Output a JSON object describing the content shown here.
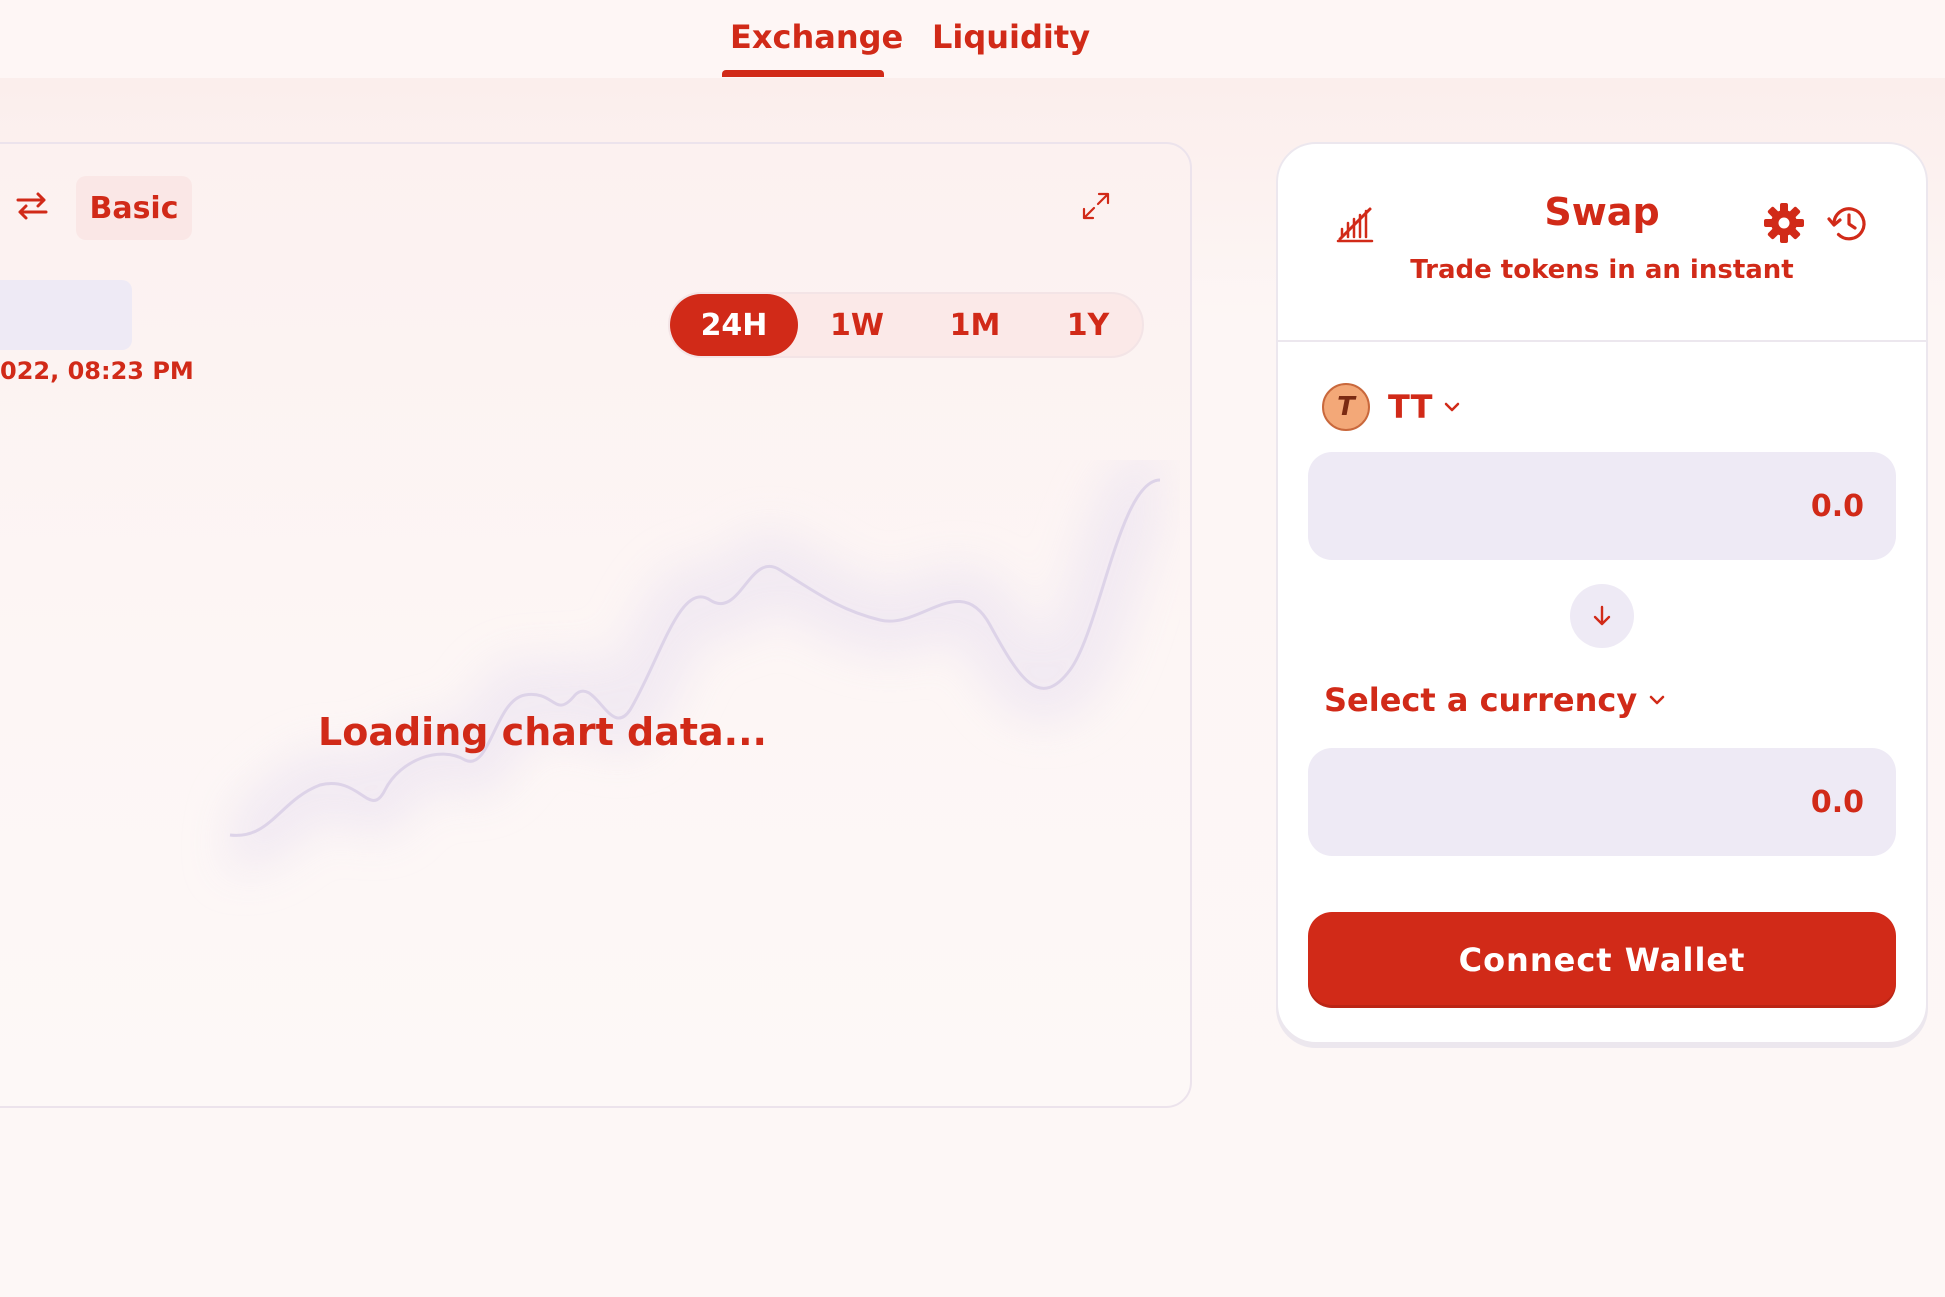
{
  "nav": {
    "tabs": [
      {
        "label": "Exchange",
        "active": true
      },
      {
        "label": "Liquidity",
        "active": false
      }
    ]
  },
  "chart_panel": {
    "view_label": "Basic",
    "date_text": "022, 08:23 PM",
    "ranges": [
      {
        "label": "24H",
        "active": true
      },
      {
        "label": "1W",
        "active": false
      },
      {
        "label": "1M",
        "active": false
      },
      {
        "label": "1Y",
        "active": false
      }
    ],
    "loading_text": "Loading chart data..."
  },
  "swap": {
    "title": "Swap",
    "subtitle": "Trade tokens in an instant",
    "from": {
      "token_symbol": "TT",
      "token_logo_letter": "T",
      "amount_placeholder": "0.0"
    },
    "to": {
      "select_label": "Select a currency",
      "amount_placeholder": "0.0"
    },
    "connect_label": "Connect Wallet"
  },
  "colors": {
    "accent": "#d12a18",
    "input_bg": "#eeeaf5",
    "chart_line": "#ddd3e8"
  },
  "icons": {
    "swap_arrows": "swap-arrows-icon",
    "expand": "expand-icon",
    "chart_toggle": "chart-toggle-icon",
    "settings": "gear-icon",
    "history": "history-icon",
    "switch": "arrow-down-icon",
    "dropdown": "chevron-down-icon"
  }
}
